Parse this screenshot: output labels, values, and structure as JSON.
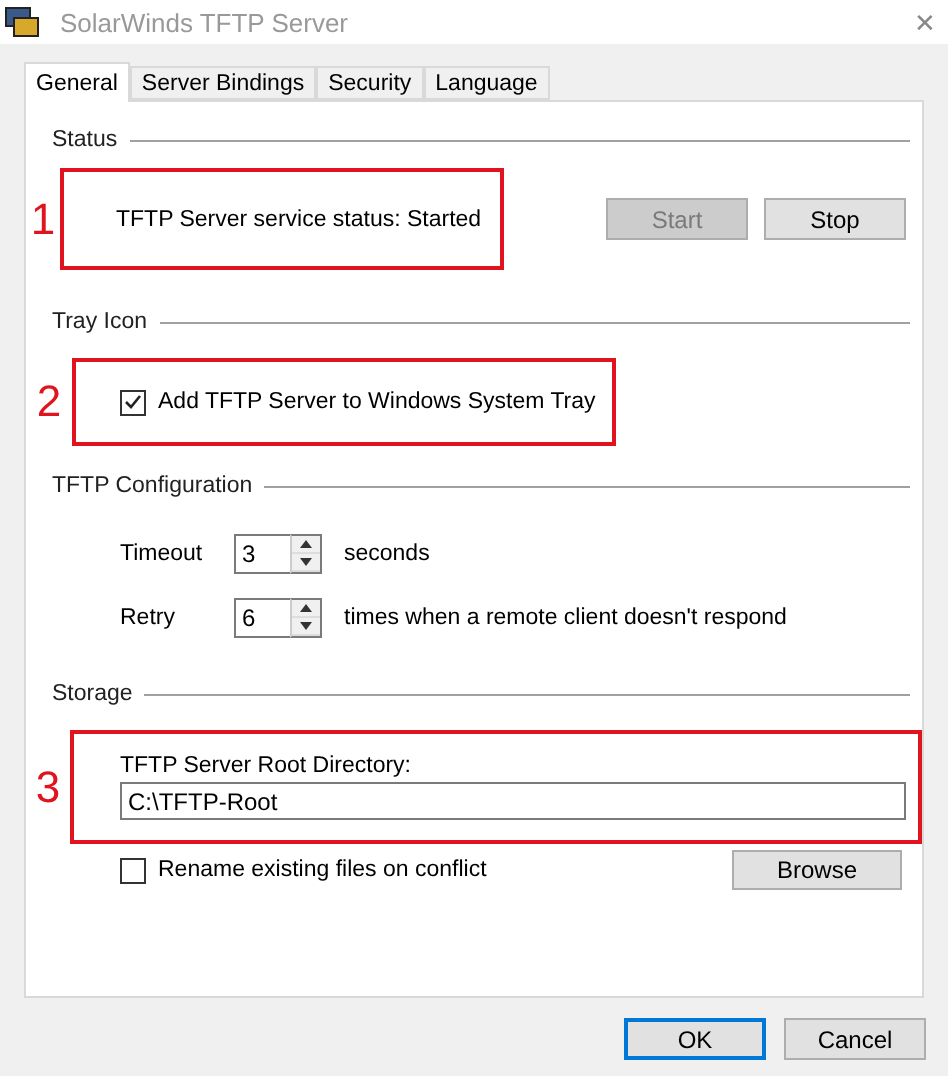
{
  "window": {
    "title": "SolarWinds TFTP Server",
    "close": "✕"
  },
  "tabs": [
    {
      "label": "General",
      "selected": true
    },
    {
      "label": "Server Bindings",
      "selected": false
    },
    {
      "label": "Security",
      "selected": false
    },
    {
      "label": "Language",
      "selected": false
    }
  ],
  "status": {
    "heading": "Status",
    "callout": "1",
    "status_text": "TFTP Server service status: Started",
    "buttons": [
      {
        "label": "Start",
        "disabled": true
      },
      {
        "label": "Stop",
        "disabled": false
      }
    ]
  },
  "tray_icon": {
    "heading": "Tray Icon",
    "callout": "2",
    "checkbox": {
      "label": "Add TFTP Server to Windows System Tray",
      "checked": true
    }
  },
  "configuration": {
    "heading": "TFTP Configuration",
    "rows": [
      {
        "label": "Timeout",
        "value": "3",
        "unit": "seconds"
      },
      {
        "label": "Retry",
        "value": "6",
        "unit": "times when a remote client doesn't respond"
      }
    ]
  },
  "storage": {
    "heading": "Storage",
    "callout": "3",
    "root_label": "TFTP Server Root Directory:",
    "root_value": "C:\\TFTP-Root",
    "rename": {
      "label": "Rename existing files on conflict",
      "checked": false
    },
    "browse": "Browse"
  },
  "buttons": [
    {
      "label": "OK",
      "default": true
    },
    {
      "label": "Cancel",
      "default": false
    }
  ]
}
